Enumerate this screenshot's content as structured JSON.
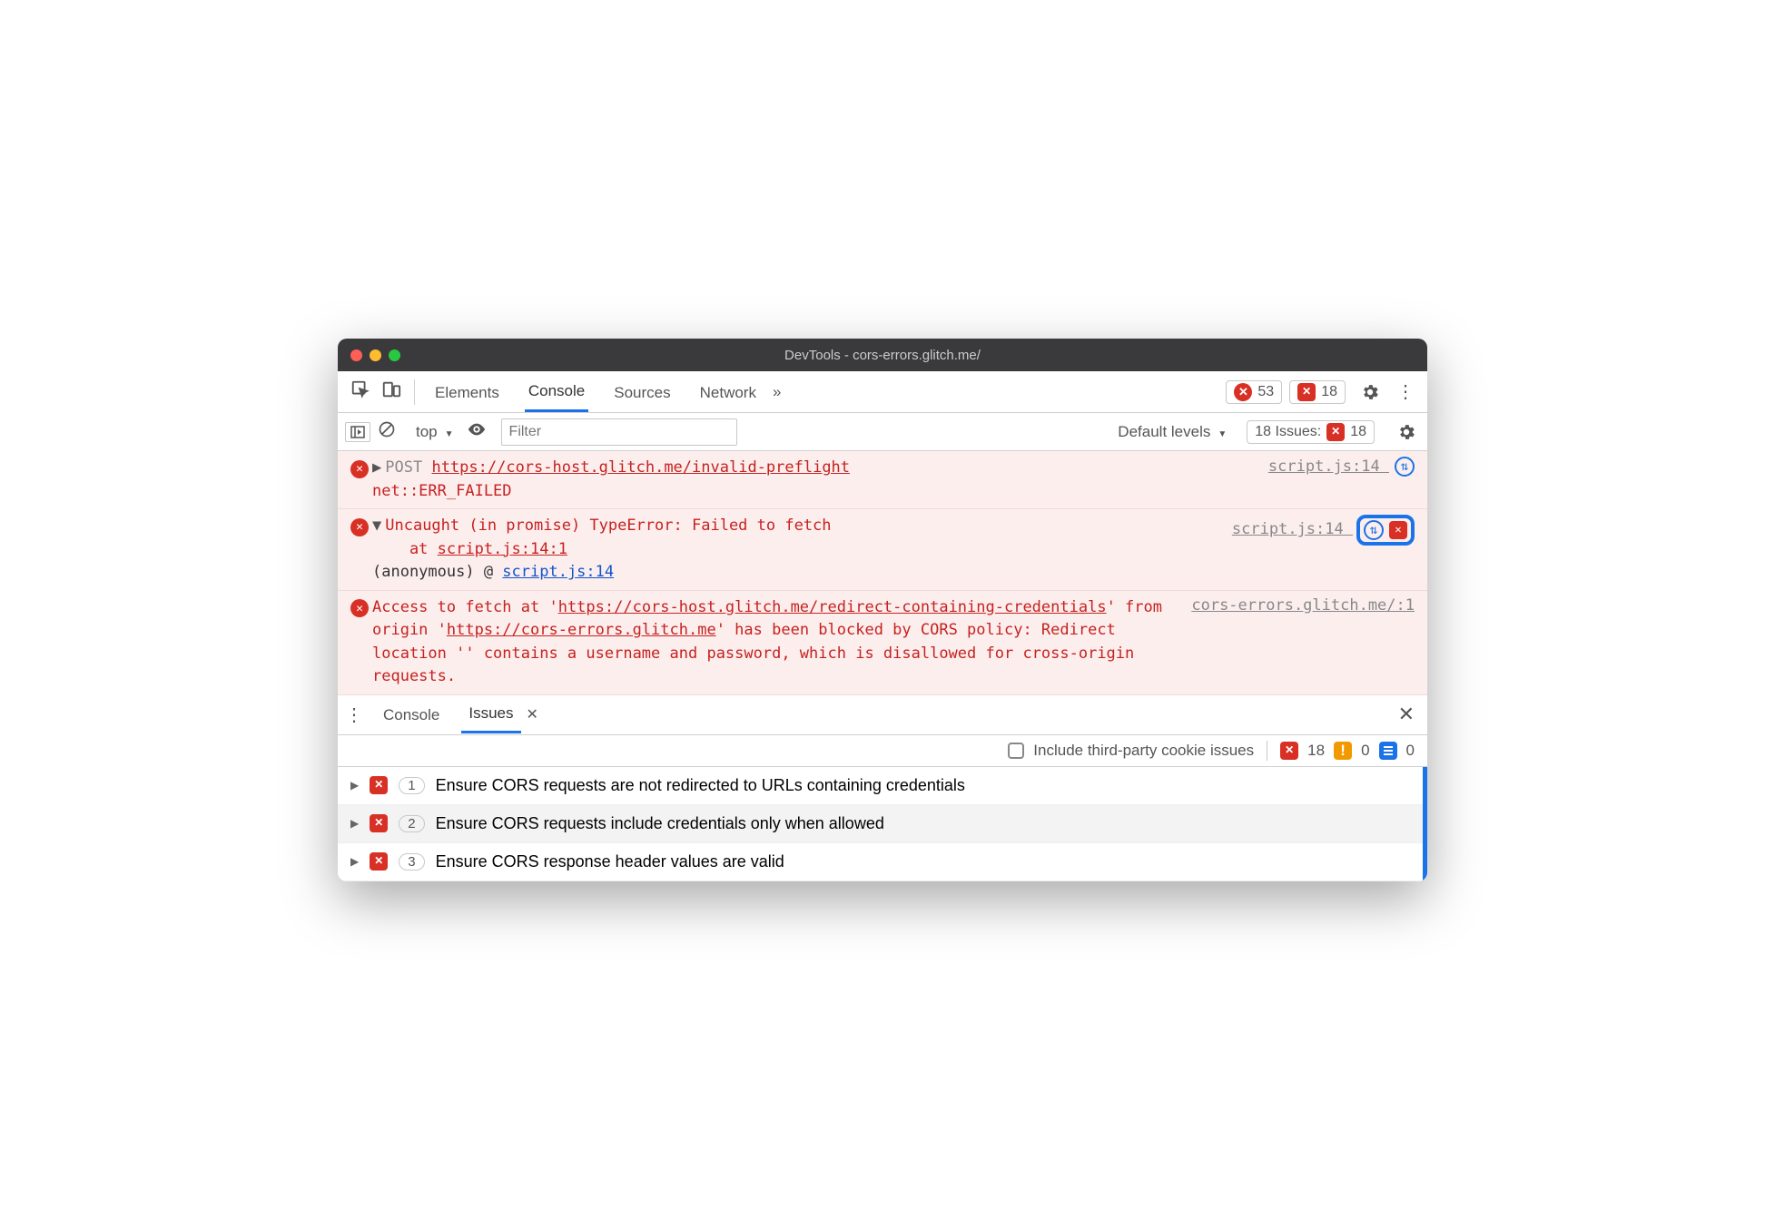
{
  "window": {
    "title": "DevTools - cors-errors.glitch.me/"
  },
  "toolbar": {
    "tabs": [
      "Elements",
      "Console",
      "Sources",
      "Network"
    ],
    "activeTab": "Console",
    "errorCount": "53",
    "issueCount": "18"
  },
  "subbar": {
    "context": "top",
    "filterPlaceholder": "Filter",
    "levels": "Default levels",
    "issuesLabel": "18 Issues:",
    "issuesCount": "18"
  },
  "console": {
    "rows": [
      {
        "arrow": "▶",
        "prefix": "POST",
        "url": "https://cors-host.glitch.me/invalid-preflight",
        "line2": "net::ERR_FAILED",
        "source": "script.js:14",
        "netIcon": true
      },
      {
        "arrow": "▼",
        "text1": "Uncaught (in promise) TypeError: Failed to fetch",
        "text2_pre": "    at ",
        "text2_link": "script.js:14:1",
        "text3_pre": "(anonymous) @ ",
        "text3_link": "script.js:14",
        "source": "script.js:14",
        "highlighted": true
      },
      {
        "arrow": "",
        "msg_p1": "Access to fetch at '",
        "msg_u1": "https://cors-host.glitch.me/redirect-containing-credentials",
        "msg_p2": "' from origin '",
        "msg_u2": "https://cors-errors.glitch.me",
        "msg_p3": "' has been blocked by CORS policy: Redirect location '' contains a username and password, which is disallowed for cross-origin requests.",
        "source": "cors-errors.glitch.me/:1"
      }
    ]
  },
  "drawer": {
    "tabs": [
      "Console",
      "Issues"
    ],
    "activeTab": "Issues",
    "checkboxLabel": "Include third-party cookie issues",
    "counts": {
      "errors": "18",
      "warnings": "0",
      "info": "0"
    },
    "issues": [
      {
        "count": "1",
        "text": "Ensure CORS requests are not redirected to URLs containing credentials"
      },
      {
        "count": "2",
        "text": "Ensure CORS requests include credentials only when allowed"
      },
      {
        "count": "3",
        "text": "Ensure CORS response header values are valid"
      }
    ]
  }
}
